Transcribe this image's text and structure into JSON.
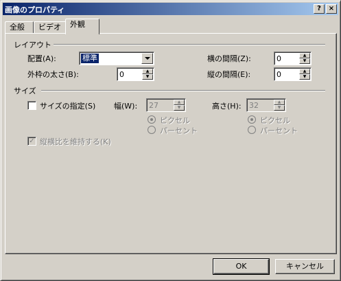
{
  "window": {
    "title": "画像のプロパティ",
    "help_label": "?",
    "close_label": "×"
  },
  "tabs": [
    {
      "label": "全般",
      "active": false
    },
    {
      "label": "ビデオ",
      "active": false
    },
    {
      "label": "外観",
      "active": true
    }
  ],
  "layout": {
    "section_label": "レイアウト",
    "align_label": "配置(A):",
    "align_value": "標準",
    "border_label": "外枠の太さ(B):",
    "border_value": "0",
    "hspace_label": "横の間隔(Z):",
    "hspace_value": "0",
    "vspace_label": "縦の間隔(E):",
    "vspace_value": "0"
  },
  "size": {
    "section_label": "サイズ",
    "specify_label": "サイズの指定(S)",
    "specify_checked": false,
    "width_label": "幅(W):",
    "width_value": "27",
    "height_label": "高さ(H):",
    "height_value": "32",
    "pixels_label": "ピクセル",
    "percent_label": "パーセント",
    "keep_ratio_label": "縦横比を維持する(K)",
    "keep_ratio_checked": true
  },
  "buttons": {
    "ok": "OK",
    "cancel": "キャンセル"
  },
  "icons": {
    "check": "✓",
    "spin_up": "▲",
    "spin_down": "▼"
  }
}
